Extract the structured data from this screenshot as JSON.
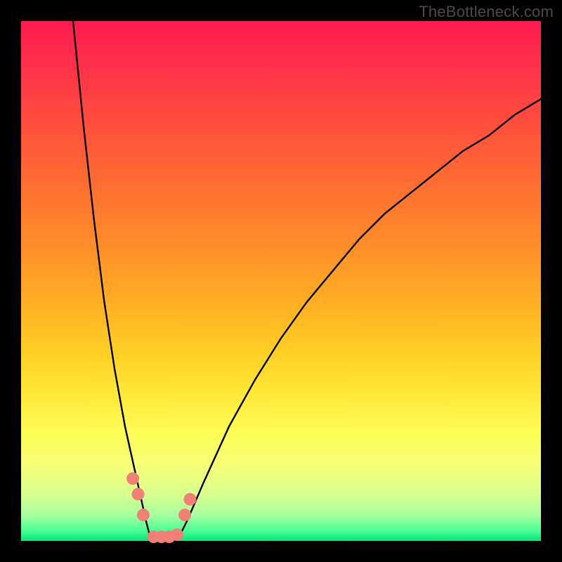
{
  "watermark": "TheBottleneck.com",
  "colors": {
    "background": "#000000",
    "gradient_top": "#ff1a4d",
    "gradient_bottom": "#00e87a",
    "curve_stroke": "#000000",
    "marker_fill": "#f08174",
    "marker_stroke": "#f08174"
  },
  "chart_data": {
    "type": "line",
    "title": "",
    "xlabel": "",
    "ylabel": "",
    "xlim": [
      0,
      100
    ],
    "ylim": [
      0,
      100
    ],
    "grid": false,
    "legend": false,
    "note": "V-shaped bottleneck curve; x is component performance index (0-100), y is bottleneck percentage (0-100). Minimum (≈0%) near x≈25; left branch rises steeply to 100 at x≈10; right branch rises to ≈85 at x=100.",
    "series": [
      {
        "name": "left_branch",
        "x": [
          10,
          12,
          14,
          16,
          18,
          20,
          22,
          24,
          25
        ],
        "values": [
          100,
          80,
          62,
          46,
          33,
          22,
          13,
          4,
          0
        ]
      },
      {
        "name": "flat_min",
        "x": [
          25,
          26,
          27,
          28,
          29,
          30
        ],
        "values": [
          0,
          0,
          0,
          0,
          0,
          0
        ]
      },
      {
        "name": "right_branch",
        "x": [
          30,
          32,
          35,
          40,
          45,
          50,
          55,
          60,
          65,
          70,
          75,
          80,
          85,
          90,
          95,
          100
        ],
        "values": [
          0,
          4,
          11,
          22,
          31,
          39,
          46,
          52,
          58,
          63,
          67,
          71,
          75,
          78,
          82,
          85
        ]
      }
    ],
    "markers": [
      {
        "name": "left_cluster_1",
        "x": 21.5,
        "y": 12
      },
      {
        "name": "left_cluster_2",
        "x": 22.5,
        "y": 9
      },
      {
        "name": "left_cluster_3",
        "x": 23.5,
        "y": 5
      },
      {
        "name": "bottom_1",
        "x": 25.5,
        "y": 0.8
      },
      {
        "name": "bottom_2",
        "x": 27.0,
        "y": 0.8
      },
      {
        "name": "bottom_3",
        "x": 28.5,
        "y": 0.8
      },
      {
        "name": "bottom_4",
        "x": 30.0,
        "y": 1.2
      },
      {
        "name": "right_cluster_1",
        "x": 31.5,
        "y": 5
      },
      {
        "name": "right_cluster_2",
        "x": 32.5,
        "y": 8
      }
    ]
  }
}
